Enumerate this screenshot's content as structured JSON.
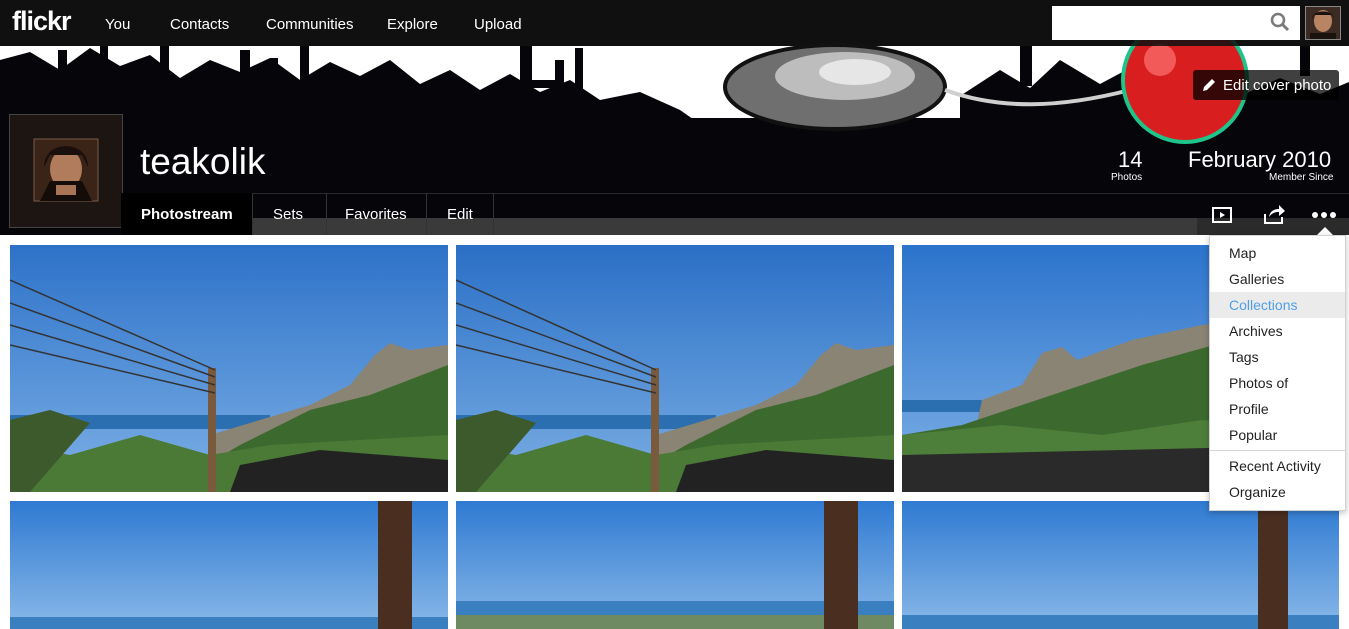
{
  "nav": {
    "logo": "flickr",
    "items": [
      "You",
      "Contacts",
      "Communities",
      "Explore",
      "Upload"
    ],
    "search_placeholder": ""
  },
  "cover": {
    "edit_label": "Edit cover photo"
  },
  "profile": {
    "username": "teakolik",
    "photos_count": "14",
    "photos_label": "Photos",
    "member_since": "February 2010",
    "member_since_label": "Member Since"
  },
  "tabs": [
    "Photostream",
    "Sets",
    "Favorites",
    "Edit"
  ],
  "more_menu": {
    "items": [
      "Map",
      "Galleries",
      "Collections",
      "Archives",
      "Tags",
      "Photos of",
      "Profile",
      "Popular"
    ],
    "items_secondary": [
      "Recent Activity",
      "Organize"
    ],
    "highlighted": "Collections"
  },
  "colors": {
    "accent_link": "#4f9ee8",
    "nav_bg": "#121212",
    "sky": "#3a86d8"
  },
  "icons": {
    "slideshow": "slideshow-icon",
    "share": "share-icon",
    "more": "more-icon",
    "search": "search-icon",
    "edit": "pencil-icon"
  }
}
